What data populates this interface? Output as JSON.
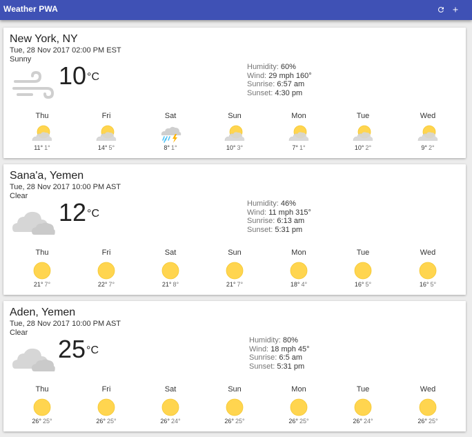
{
  "app": {
    "title": "Weather PWA"
  },
  "cards": [
    {
      "location": "New York, NY",
      "date": "Tue, 28 Nov 2017 02:00 PM EST",
      "description": "Sunny",
      "main_icon": "wind-icon",
      "temperature": "10",
      "unit": "°C",
      "humidity_label": "Humidity:",
      "humidity": "60%",
      "wind_label": "Wind:",
      "wind": "29 mph 160°",
      "sunrise_label": "Sunrise:",
      "sunrise": "6:57 am",
      "sunset_label": "Sunset:",
      "sunset": "4:30 pm",
      "forecast": [
        {
          "day": "Thu",
          "icon": "partly-cloudy-icon",
          "high": "11°",
          "low": "1°"
        },
        {
          "day": "Fri",
          "icon": "partly-cloudy-icon",
          "high": "14°",
          "low": "5°"
        },
        {
          "day": "Sat",
          "icon": "thunderstorm-icon",
          "high": "8°",
          "low": "1°"
        },
        {
          "day": "Sun",
          "icon": "partly-cloudy-icon",
          "high": "10°",
          "low": "3°"
        },
        {
          "day": "Mon",
          "icon": "partly-cloudy-icon",
          "high": "7°",
          "low": "1°"
        },
        {
          "day": "Tue",
          "icon": "partly-cloudy-icon",
          "high": "10°",
          "low": "2°"
        },
        {
          "day": "Wed",
          "icon": "partly-cloudy-icon",
          "high": "9°",
          "low": "2°"
        }
      ]
    },
    {
      "location": "Sana'a, Yemen",
      "date": "Tue, 28 Nov 2017 10:00 PM AST",
      "description": "Clear",
      "main_icon": "cloudy-icon",
      "temperature": "12",
      "unit": "°C",
      "humidity_label": "Humidity:",
      "humidity": "46%",
      "wind_label": "Wind:",
      "wind": "11 mph 315°",
      "sunrise_label": "Sunrise:",
      "sunrise": "6:13 am",
      "sunset_label": "Sunset:",
      "sunset": "5:31 pm",
      "forecast": [
        {
          "day": "Thu",
          "icon": "sun-icon",
          "high": "21°",
          "low": "7°"
        },
        {
          "day": "Fri",
          "icon": "sun-icon",
          "high": "22°",
          "low": "7°"
        },
        {
          "day": "Sat",
          "icon": "sun-icon",
          "high": "21°",
          "low": "8°"
        },
        {
          "day": "Sun",
          "icon": "sun-icon",
          "high": "21°",
          "low": "7°"
        },
        {
          "day": "Mon",
          "icon": "sun-icon",
          "high": "18°",
          "low": "4°"
        },
        {
          "day": "Tue",
          "icon": "sun-icon",
          "high": "16°",
          "low": "5°"
        },
        {
          "day": "Wed",
          "icon": "sun-icon",
          "high": "16°",
          "low": "5°"
        }
      ]
    },
    {
      "location": "Aden, Yemen",
      "date": "Tue, 28 Nov 2017 10:00 PM AST",
      "description": "Clear",
      "main_icon": "cloudy-icon",
      "temperature": "25",
      "unit": "°C",
      "humidity_label": "Humidity:",
      "humidity": "80%",
      "wind_label": "Wind:",
      "wind": "18 mph 45°",
      "sunrise_label": "Sunrise:",
      "sunrise": "6:5 am",
      "sunset_label": "Sunset:",
      "sunset": "5:31 pm",
      "forecast": [
        {
          "day": "Thu",
          "icon": "sun-icon",
          "high": "26°",
          "low": "25°"
        },
        {
          "day": "Fri",
          "icon": "sun-icon",
          "high": "26°",
          "low": "25°"
        },
        {
          "day": "Sat",
          "icon": "sun-icon",
          "high": "26°",
          "low": "24°"
        },
        {
          "day": "Sun",
          "icon": "sun-icon",
          "high": "26°",
          "low": "25°"
        },
        {
          "day": "Mon",
          "icon": "sun-icon",
          "high": "26°",
          "low": "25°"
        },
        {
          "day": "Tue",
          "icon": "sun-icon",
          "high": "26°",
          "low": "24°"
        },
        {
          "day": "Wed",
          "icon": "sun-icon",
          "high": "26°",
          "low": "25°"
        }
      ]
    }
  ],
  "colors": {
    "appbar": "#3f51b5",
    "sun": "#ffd54f",
    "sun_outline": "#f5c832",
    "cloud": "#dcdcdc",
    "rain": "#4fc3f7",
    "bolt": "#ffb300"
  }
}
